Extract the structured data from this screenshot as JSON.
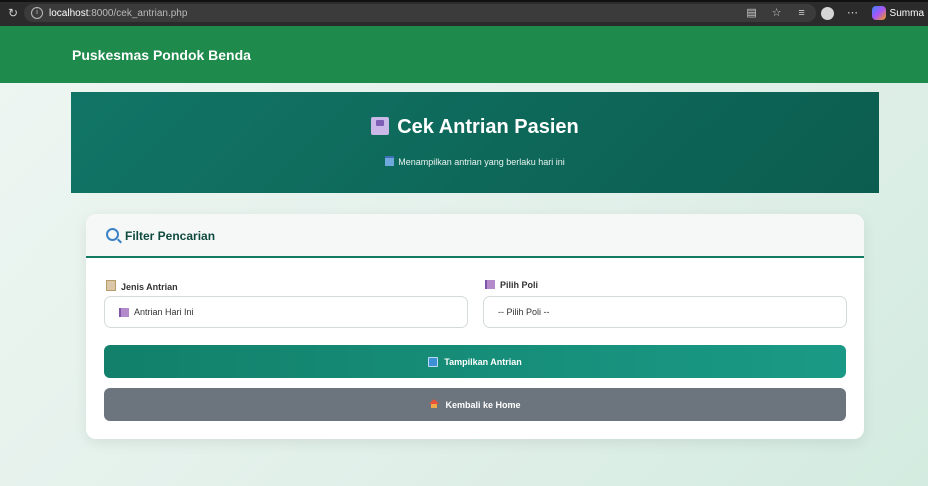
{
  "browser": {
    "url_host": "localhost",
    "url_rest": ":8000/cek_antrian.php",
    "summary_label": "Summa"
  },
  "navbar": {
    "brand": "Puskesmas Pondok Benda"
  },
  "hero": {
    "title": "Cek Antrian Pasien",
    "subtitle": "Menampilkan antrian yang berlaku hari ini"
  },
  "filter": {
    "title": "Filter Pencarian",
    "jenis_label": "Jenis Antrian",
    "jenis_value": "Antrian Hari Ini",
    "poli_label": "Pilih Poli",
    "poli_value": "-- Pilih Poli --",
    "show_button": "Tampilkan Antrian",
    "home_button": "Kembali ke Home"
  },
  "colors": {
    "navbar": "#1e8a4c",
    "hero": "#0f6a5a",
    "primary_button": "#12806a",
    "secondary_button": "#6c757d"
  }
}
